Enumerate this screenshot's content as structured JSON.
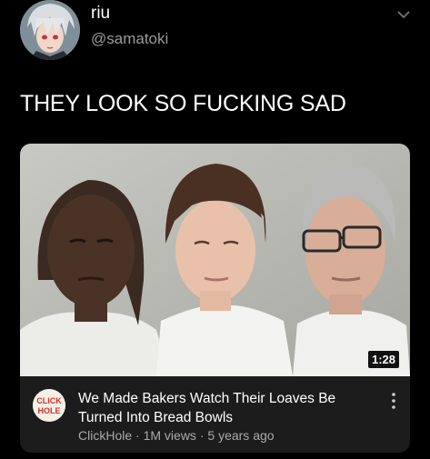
{
  "tweet": {
    "display_name": "riu",
    "handle": "@samatoki",
    "text": "THEY LOOK SO FUCKING SAD",
    "avatar_icon": "anime-avatar",
    "menu_icon": "chevron-down-icon"
  },
  "video": {
    "duration": "1:28",
    "title_line1": "We Made Bakers Watch Their Loaves Be",
    "title_line2": "Turned Into Bread Bowls",
    "channel": "ClickHole",
    "views": "1M views",
    "age": "5 years ago",
    "separator": "·",
    "logo_line1": "CLICK",
    "logo_line2": "HOLE",
    "logo_color": "#d8302a"
  }
}
